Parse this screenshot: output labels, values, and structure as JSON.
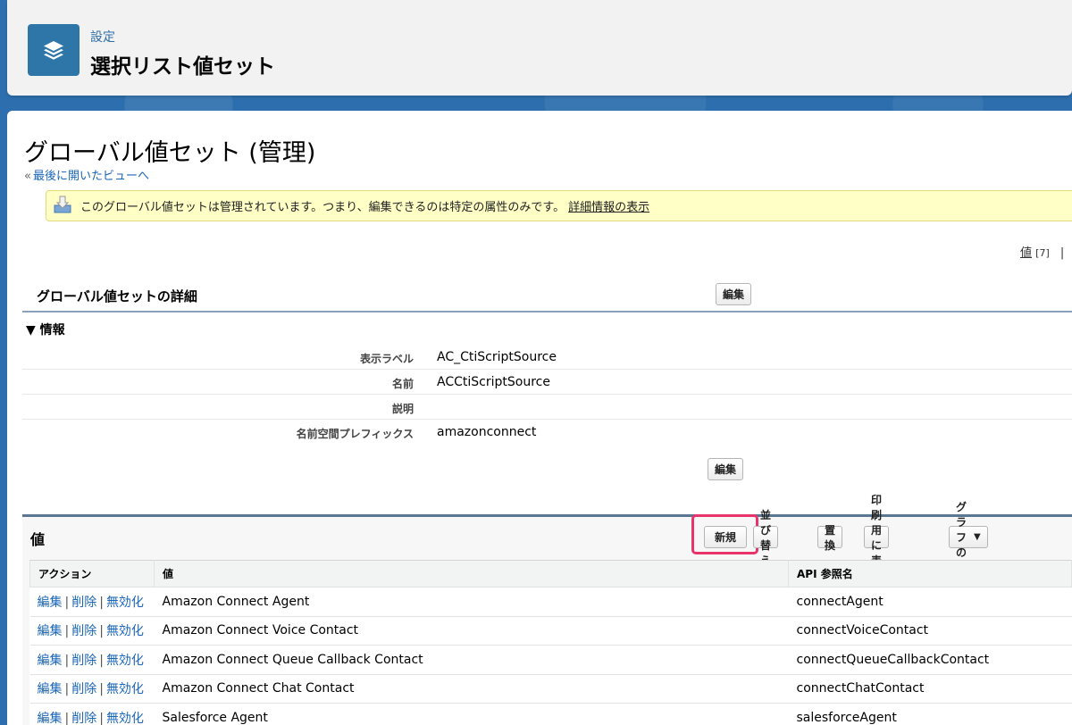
{
  "header": {
    "eyebrow": "設定",
    "title": "選択リスト値セット",
    "icon": "stack-layers-icon"
  },
  "page": {
    "title": "グローバル値セット (管理)",
    "back_link": "最後に開いたビューへ"
  },
  "banner": {
    "message": "このグローバル値セットは管理されています。つまり、編集できるのは特定の属性のみです。",
    "link": "詳細情報の表示"
  },
  "right_links": {
    "values_label": "値",
    "values_count": "[7]",
    "separator": "|"
  },
  "detail": {
    "title": "グローバル値セットの詳細",
    "edit_label": "編集",
    "section_label": "情報",
    "fields": [
      {
        "label": "表示ラベル",
        "value": "AC_CtiScriptSource"
      },
      {
        "label": "名前",
        "value": "ACCtiScriptSource"
      },
      {
        "label": "説明",
        "value": ""
      },
      {
        "label": "名前空間プレフィックス",
        "value": "amazonconnect"
      }
    ]
  },
  "values_section": {
    "title": "値",
    "buttons": {
      "new": "新規",
      "reorder": "並び替え",
      "replace": "置換",
      "printable": "印刷用に表示",
      "chart_colors": "グラフの色"
    },
    "columns": [
      "アクション",
      "値",
      "API 参照名"
    ],
    "action_labels": {
      "edit": "編集",
      "delete": "削除",
      "deactivate": "無効化"
    },
    "rows": [
      {
        "value": "Amazon Connect Agent",
        "api": "connectAgent"
      },
      {
        "value": "Amazon Connect Voice Contact",
        "api": "connectVoiceContact"
      },
      {
        "value": "Amazon Connect Queue Callback Contact",
        "api": "connectQueueCallbackContact"
      },
      {
        "value": "Amazon Connect Chat Contact",
        "api": "connectChatContact"
      },
      {
        "value": "Salesforce Agent",
        "api": "salesforceAgent"
      }
    ]
  },
  "colors": {
    "brand_blue": "#2e76a8",
    "link_blue": "#1a66b8",
    "highlight": "#e8336b",
    "banner_bg": "#ffffc6"
  }
}
